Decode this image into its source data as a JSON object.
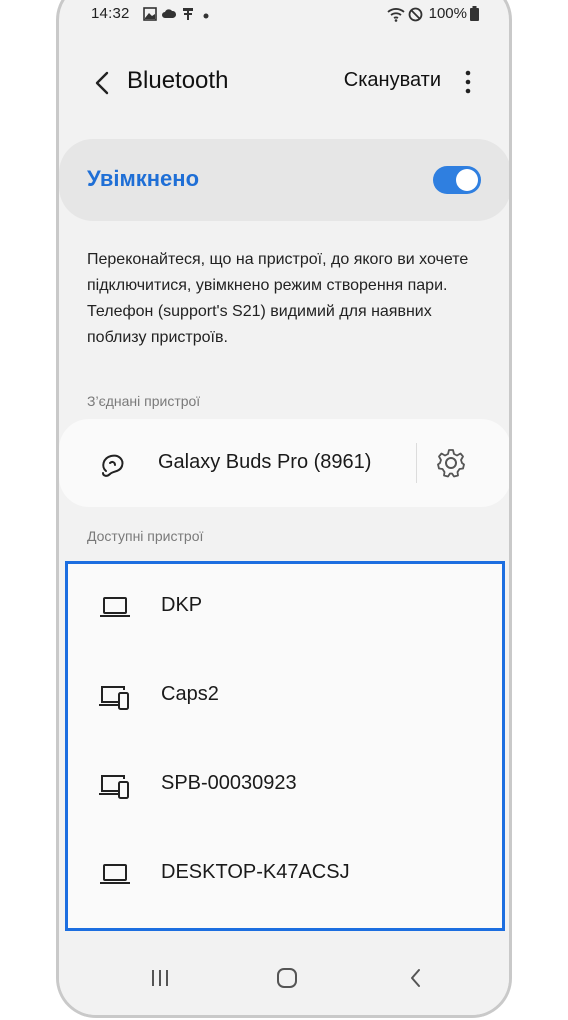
{
  "status": {
    "time": "14:32",
    "battery": "100%"
  },
  "header": {
    "title": "Bluetooth",
    "scan_label": "Сканувати"
  },
  "toggle": {
    "label": "Увімкнено",
    "on": true
  },
  "description": "Переконайтеся, що на пристрої, до якого ви хочете підключитися, увімкнено режим створення пари. Телефон (support's S21) видимий для наявних поблизу пристроїв.",
  "paired": {
    "section_label": "З’єднані пристрої",
    "device": {
      "name": "Galaxy Buds Pro (8961)",
      "icon": "earbuds-icon"
    }
  },
  "available": {
    "section_label": "Доступні пристрої",
    "devices": [
      {
        "name": "DKP",
        "icon": "laptop-icon"
      },
      {
        "name": "Caps2",
        "icon": "multi-device-icon"
      },
      {
        "name": "SPB-00030923",
        "icon": "multi-device-icon"
      },
      {
        "name": "DESKTOP-K47ACSJ",
        "icon": "laptop-icon"
      }
    ]
  },
  "colors": {
    "accent": "#1f6fd6",
    "highlight_border": "#1c6ee0",
    "switch_on": "#2f7fe0"
  }
}
